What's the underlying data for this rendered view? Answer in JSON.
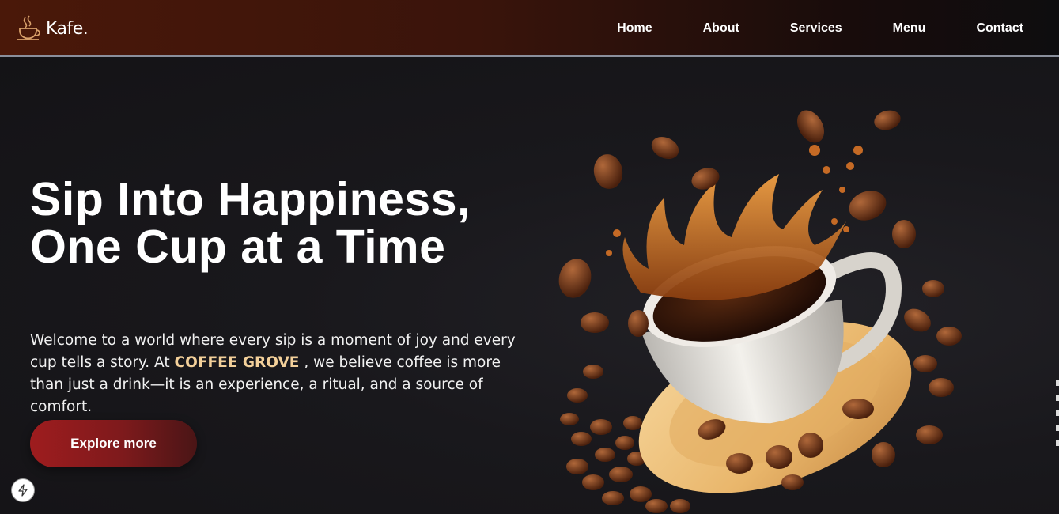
{
  "brand": {
    "logo_text": "Kafe.",
    "logo_icon": "coffee-cup-icon"
  },
  "nav": {
    "items": [
      {
        "label": "Home"
      },
      {
        "label": "About"
      },
      {
        "label": "Services"
      },
      {
        "label": "Menu"
      },
      {
        "label": "Contact"
      }
    ]
  },
  "hero": {
    "headline": "Sip Into Happiness, One Cup at a Time",
    "lead_before": "Welcome to a world where every sip is a moment of joy and every cup tells a story. At ",
    "lead_brand": "COFFEE GROVE",
    "lead_after": " , we believe coffee is more than just a drink—it is an experience, a ritual, and a source of comfort.",
    "cta_label": "Explore more",
    "image": "coffee-cup-splash-with-beans"
  },
  "floating_button": {
    "icon": "lightning-bolt-icon"
  },
  "colors": {
    "nav_gradient_start": "#4a1809",
    "hero_background": "#161518",
    "brand_highlight": "#f3d09a",
    "cta_red": "#9e1c1e"
  }
}
